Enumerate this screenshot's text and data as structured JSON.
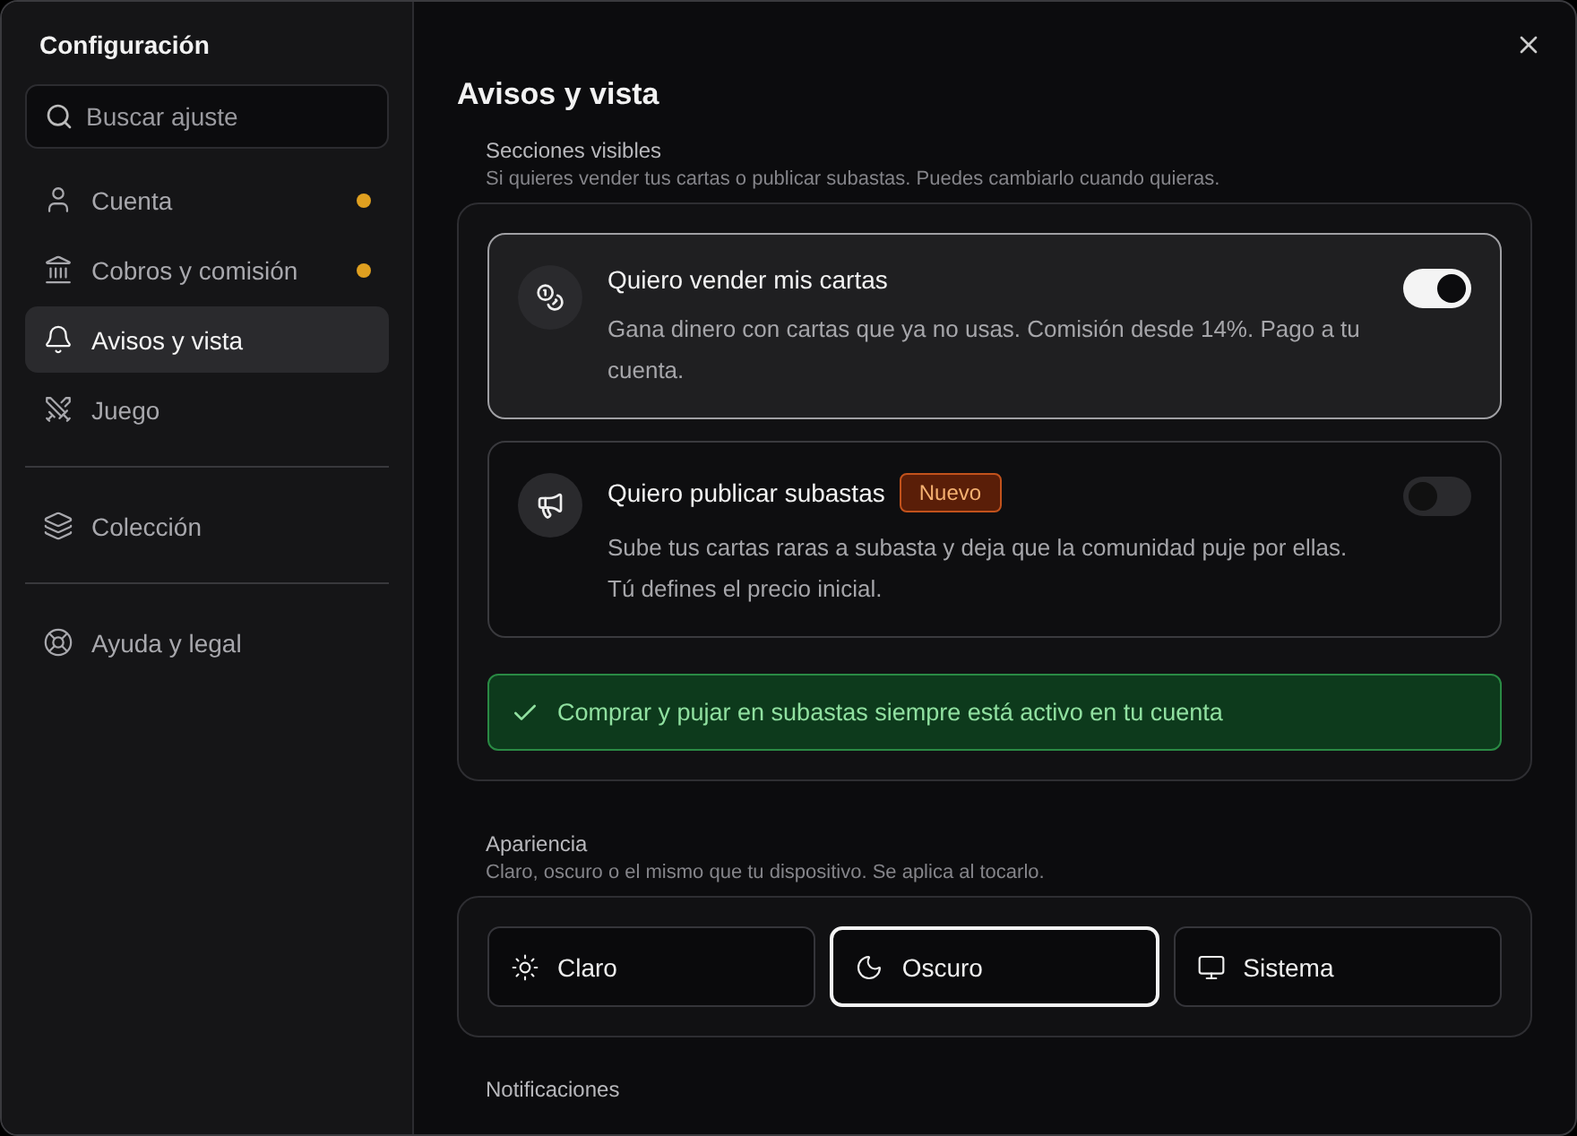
{
  "sidebar": {
    "title": "Configuración",
    "search": {
      "placeholder": "Buscar ajuste"
    },
    "groups": [
      [
        {
          "label": "Cuenta",
          "selected": false,
          "badge": true
        },
        {
          "label": "Cobros y comisión",
          "selected": false,
          "badge": true
        },
        {
          "label": "Avisos y vista",
          "selected": true,
          "badge": false
        },
        {
          "label": "Juego",
          "selected": false,
          "badge": false
        }
      ],
      [
        {
          "label": "Colección",
          "selected": false,
          "badge": false
        }
      ],
      [
        {
          "label": "Ayuda y legal",
          "selected": false,
          "badge": false
        }
      ]
    ]
  },
  "main": {
    "title": "Avisos y vista",
    "sections_visible": {
      "label": "Secciones visibles",
      "description": "Si quieres vender tus cartas o publicar subastas. Puedes cambiarlo cuando quieras.",
      "options": [
        {
          "title": "Quiero vender mis cartas",
          "description": "Gana dinero con cartas que ya no usas. Comisión desde 14%. Pago a tu cuenta.",
          "on": true
        },
        {
          "title": "Quiero publicar subastas",
          "tag": "Nuevo",
          "description": "Sube tus cartas raras a subasta y deja que la comunidad puje por ellas. Tú defines el precio inicial.",
          "on": false
        }
      ],
      "notice": "Comprar y pujar en subastas siempre está activo en tu cuenta"
    },
    "appearance": {
      "label": "Apariencia",
      "description": "Claro, oscuro o el mismo que tu dispositivo. Se aplica al tocarlo.",
      "options": [
        {
          "label": "Claro",
          "selected": false
        },
        {
          "label": "Oscuro",
          "selected": true
        },
        {
          "label": "Sistema",
          "selected": false
        }
      ]
    },
    "next_section": {
      "label": "Notificaciones"
    }
  }
}
